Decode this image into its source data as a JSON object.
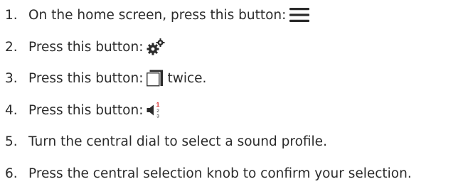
{
  "steps": [
    {
      "number": "1.",
      "text": "On the home screen, press this button:",
      "icon": "menu-icon",
      "suffix": ""
    },
    {
      "number": "2.",
      "text": "Press this button:",
      "icon": "settings-gears-icon",
      "suffix": ""
    },
    {
      "number": "3.",
      "text": "Press this button:",
      "icon": "window-icon",
      "suffix": "twice."
    },
    {
      "number": "4.",
      "text": "Press this button:",
      "icon": "sound-profile-icon",
      "suffix": ""
    },
    {
      "number": "5.",
      "text": "Turn the central dial to select a sound profile.",
      "icon": "",
      "suffix": ""
    },
    {
      "number": "6.",
      "text": "Press the central selection knob to confirm your selection.",
      "icon": "",
      "suffix": ""
    }
  ],
  "sound_profile_icon_numbers": [
    "1",
    "2",
    "3"
  ],
  "colors": {
    "text": "#2b2b2b",
    "accent_red": "#d62020"
  }
}
